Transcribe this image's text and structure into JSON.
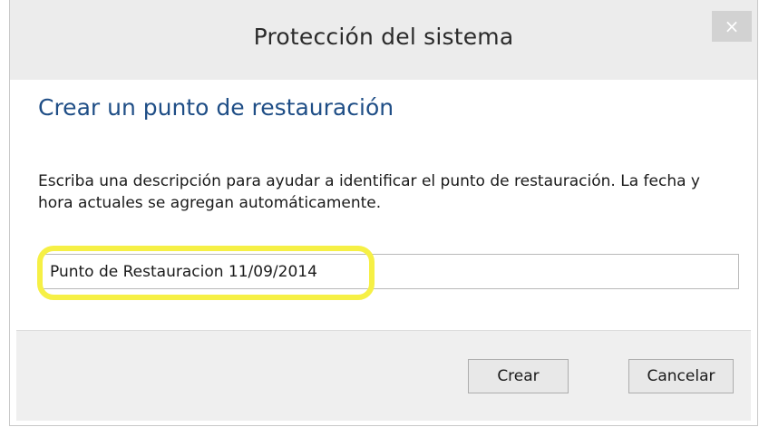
{
  "window": {
    "title": "Protección del sistema",
    "close_label": "×"
  },
  "main": {
    "heading": "Crear un punto de restauración",
    "description": "Escriba una descripción para ayudar a identificar el punto de restauración. La fecha y hora actuales se agregan automáticamente.",
    "input_value": "Punto de Restauracion 11/09/2014"
  },
  "buttons": {
    "create_label": "Crear",
    "cancel_label": "Cancelar"
  },
  "colors": {
    "heading": "#1f4e86",
    "highlight": "#f6f045",
    "titlebar": "#ececec",
    "footer": "#efefef"
  }
}
